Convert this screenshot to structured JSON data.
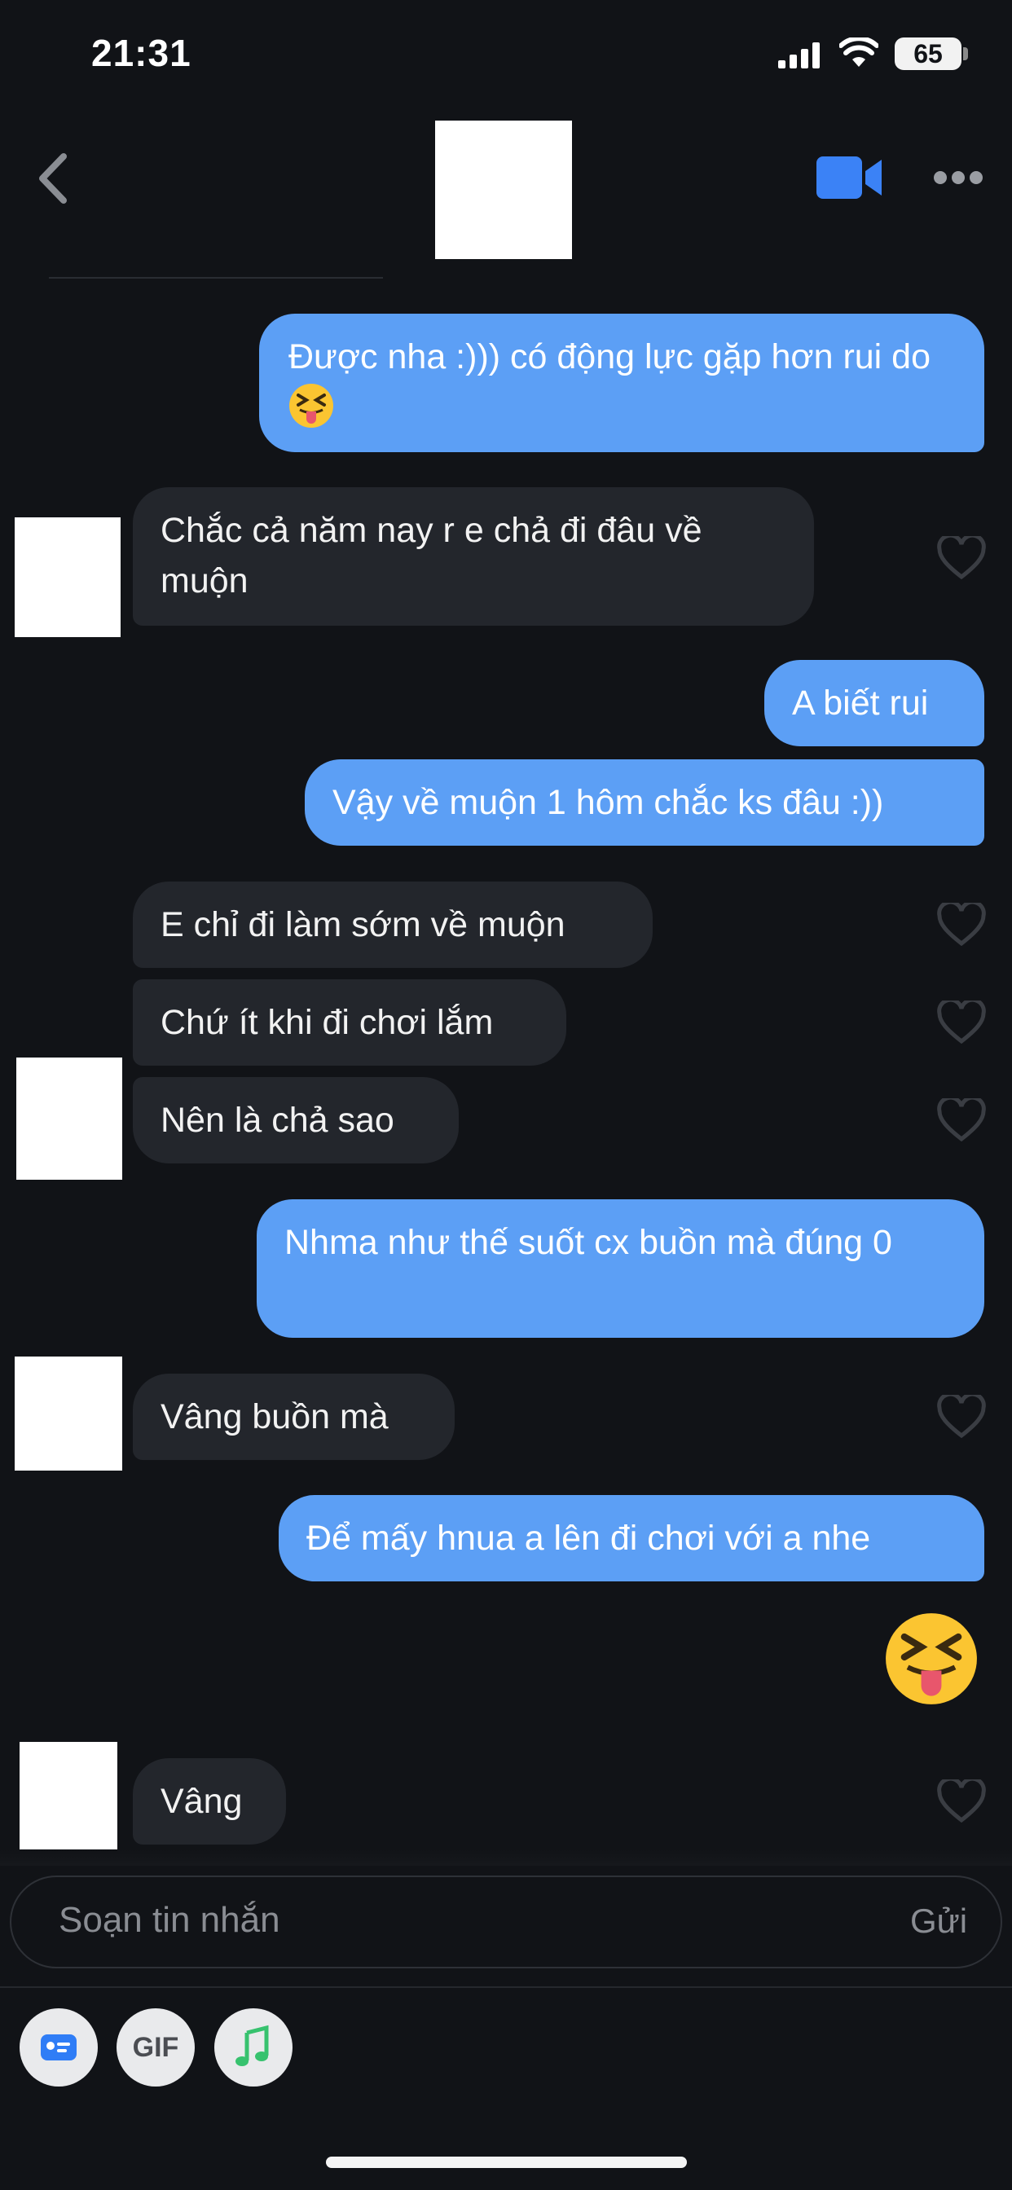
{
  "status_bar": {
    "time": "21:31",
    "battery": "65"
  },
  "header": {
    "back_icon": "chevron-left-icon",
    "video_icon": "video-camera-icon",
    "more_icon": "ellipsis-icon",
    "accent": "#3b82f6"
  },
  "colors": {
    "sent_bubble": "#5c9ff5",
    "received_bubble": "#23262c",
    "background": "#111317"
  },
  "messages": [
    {
      "side": "sent",
      "text": "Được nha :))) có động lực gặp hơn rui do",
      "emoji": "squinting-tongue-face"
    },
    {
      "side": "received",
      "text": "Chắc cả năm nay r e chả đi đâu về muộn"
    },
    {
      "side": "sent",
      "text": "A biết rui"
    },
    {
      "side": "sent",
      "text": "Vậy về muộn 1 hôm chắc ks đâu :))"
    },
    {
      "side": "received",
      "text": "E chỉ đi làm sớm về muộn"
    },
    {
      "side": "received",
      "text": "Chứ ít khi đi chơi lắm"
    },
    {
      "side": "received",
      "text": "Nên là chả sao"
    },
    {
      "side": "sent",
      "text": "Nhma như thế suốt cx buồn mà đúng 0"
    },
    {
      "side": "received",
      "text": "Vâng buồn mà"
    },
    {
      "side": "sent",
      "text": "Để mấy hnua a lên đi chơi với a nhe"
    },
    {
      "side": "sent",
      "emoji": "squinting-tongue-face"
    },
    {
      "side": "received",
      "text": "Vâng"
    }
  ],
  "composer": {
    "placeholder": "Soạn tin nhắn",
    "send_label": "Gửi"
  },
  "toolbar": {
    "gif_label": "GIF",
    "card_icon": "contact-card-icon",
    "music_icon": "music-note-icon"
  }
}
